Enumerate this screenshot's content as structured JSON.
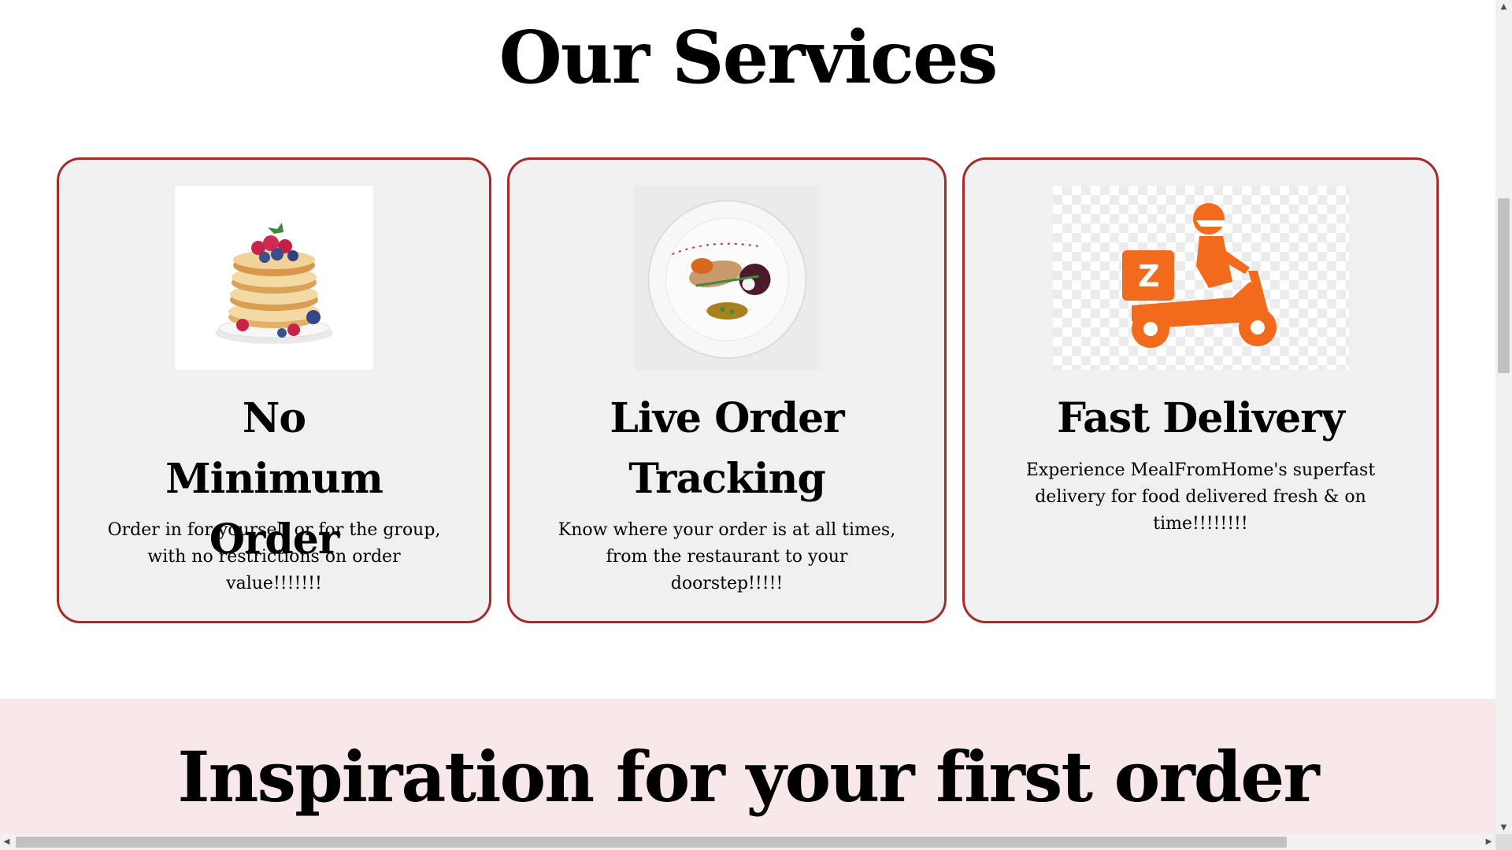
{
  "services": {
    "title": "Our Services",
    "cards": [
      {
        "image_name": "pancakes-image",
        "title": "No Minimum Order",
        "text": "Order in for yourself or for the group, with no restrictions on order value!!!!!!!"
      },
      {
        "image_name": "plated-dish-image",
        "title": "Live Order Tracking",
        "text": "Know where your order is at all times, from the restaurant to your doorstep!!!!!"
      },
      {
        "image_name": "delivery-scooter-image",
        "title": "Fast Delivery",
        "text": "Experience MealFromHome's superfast delivery for food delivered fresh & on time!!!!!!!!",
        "badge_letter": "Z"
      }
    ]
  },
  "inspiration": {
    "title": "Inspiration for your first order"
  },
  "colors": {
    "card_border": "#a52a2a",
    "card_bg": "#f0f0f0",
    "band_bg": "#f8e8ea",
    "delivery_orange": "#f26a1b"
  },
  "scrollbars": {
    "up_arrow": "▲",
    "down_arrow": "▼",
    "left_arrow": "◀",
    "right_arrow": "▶"
  }
}
